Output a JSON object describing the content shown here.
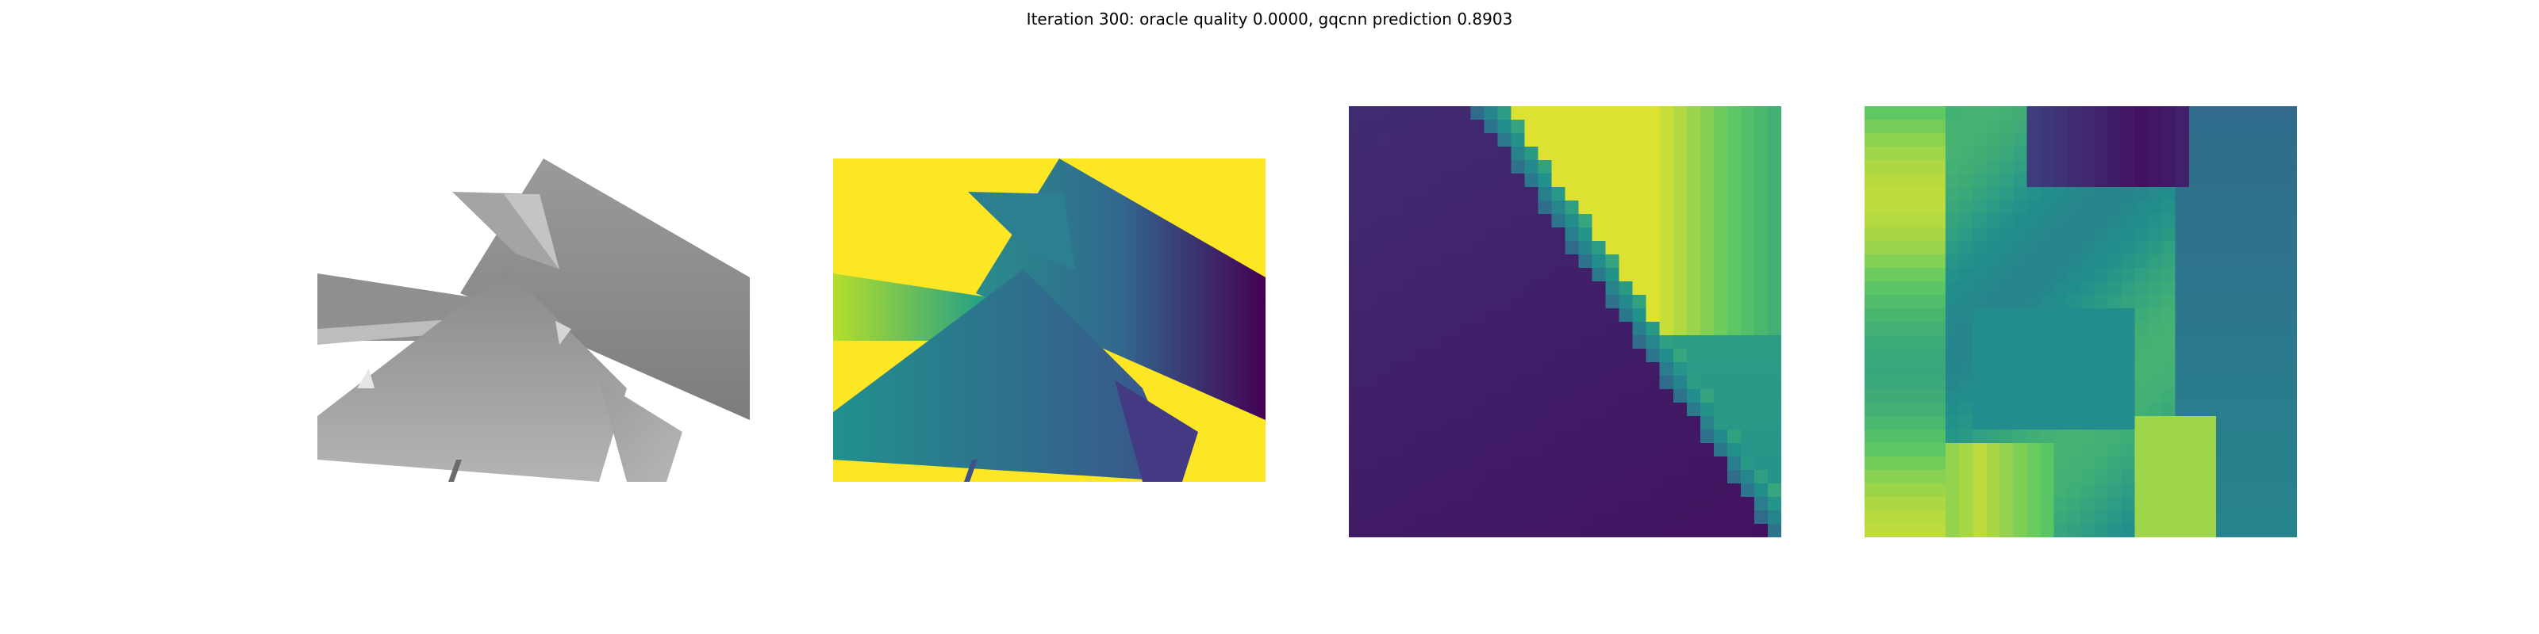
{
  "figure": {
    "title": "Iteration 300: oracle quality 0.0000, gqcnn prediction 0.8903"
  },
  "colors": {
    "background": "#ffffff",
    "render_gray": "#8e8e8e",
    "viridis_yellow": "#fde725",
    "viridis_green": "#21918c",
    "viridis_purple": "#440154"
  }
}
